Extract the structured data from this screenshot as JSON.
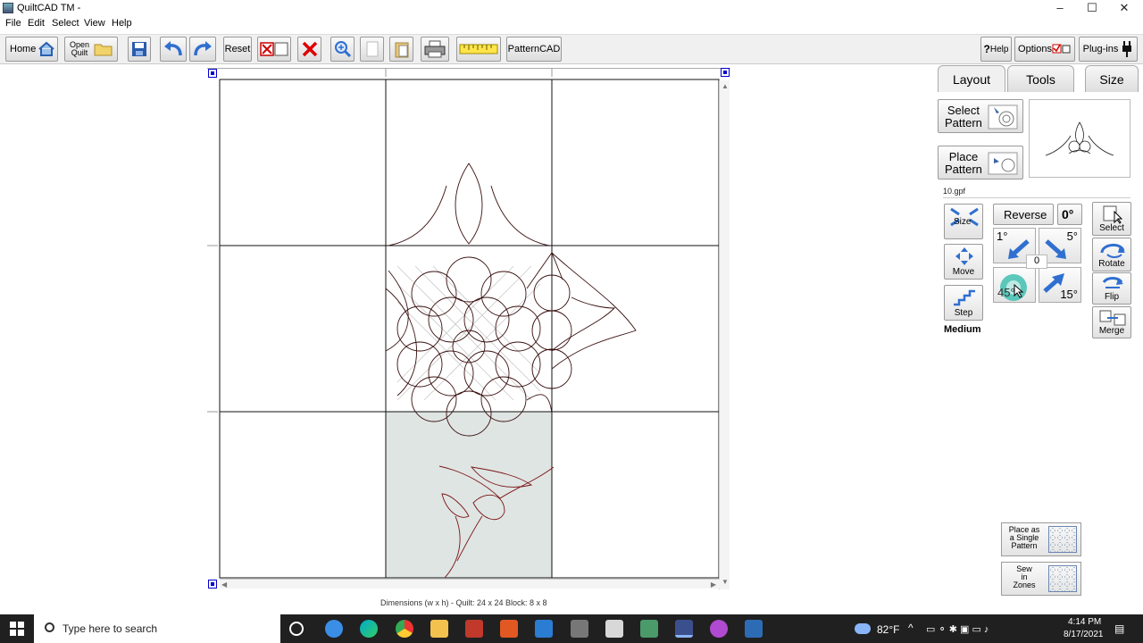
{
  "window": {
    "title": "QuiltCAD TM -",
    "minimize": "–",
    "maximize": "☐",
    "close": "✕"
  },
  "menu": [
    "File",
    "Edit",
    "Select",
    "View",
    "Help"
  ],
  "toolbar": {
    "home": "Home",
    "open_quilt_line1": "Open",
    "open_quilt_line2": "Quilt",
    "reset": "Reset",
    "patterncad": "PatternCAD",
    "help": "Help",
    "options": "Options",
    "plugins": "Plug-ins"
  },
  "canvas": {
    "status": "Dimensions (w x h) -   Quilt: 24 x 24       Block: 8 x 8"
  },
  "panel": {
    "tabs": [
      "Layout",
      "Tools",
      "Size"
    ],
    "active_tab": "Layout",
    "select_pattern_line1": "Select",
    "select_pattern_line2": "Pattern",
    "place_pattern_line1": "Place",
    "place_pattern_line2": "Pattern",
    "file_name": "10.gpf",
    "size": "Size",
    "move": "Move",
    "step": "Step",
    "step_mode": "Medium",
    "reverse": "Reverse",
    "angle": "0°",
    "rot_1": "1°",
    "rot_5": "5°",
    "rot_45": "45°",
    "rot_15": "15°",
    "rot_value": "0",
    "select": "Select",
    "rotate": "Rotate",
    "flip": "Flip",
    "merge": "Merge",
    "place_single_line1": "Place as",
    "place_single_line2": "a Single",
    "place_single_line3": "Pattern",
    "sew_zones_line1": "Sew",
    "sew_zones_line2": "in",
    "sew_zones_line3": "Zones"
  },
  "taskbar": {
    "search_placeholder": "Type here to search",
    "weather": "82°F",
    "time": "4:14 PM",
    "date": "8/17/2021"
  },
  "colors": {
    "stitch": "#7a1515",
    "selected_block": "#dfe5e3",
    "accent_blue": "#2f6fd0",
    "taskbar": "#202020"
  }
}
